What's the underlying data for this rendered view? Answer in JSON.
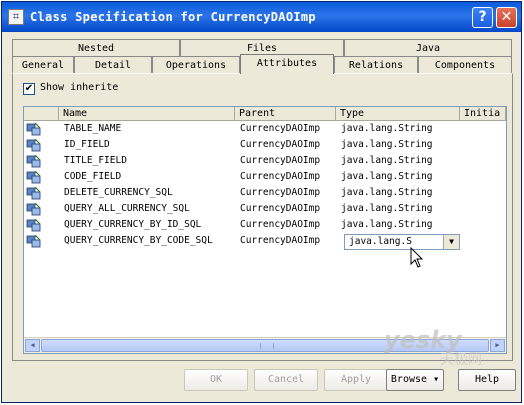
{
  "window": {
    "title": "Class Specification for CurrencyDAOImp"
  },
  "tabs": {
    "row_back": [
      "Nested",
      "Files",
      "Java"
    ],
    "row_front": [
      "General",
      "Detail",
      "Operations",
      "Attributes",
      "Relations",
      "Components"
    ],
    "active": "Attributes"
  },
  "options": {
    "show_inherited_label": "Show inherite",
    "show_inherited_checked": true
  },
  "table": {
    "headers": [
      "Name",
      "Parent",
      "Type",
      "Initia"
    ],
    "rows": [
      {
        "name": "TABLE_NAME",
        "parent": "CurrencyDAOImp",
        "type": "java.lang.String"
      },
      {
        "name": "ID_FIELD",
        "parent": "CurrencyDAOImp",
        "type": "java.lang.String"
      },
      {
        "name": "TITLE_FIELD",
        "parent": "CurrencyDAOImp",
        "type": "java.lang.String"
      },
      {
        "name": "CODE_FIELD",
        "parent": "CurrencyDAOImp",
        "type": "java.lang.String"
      },
      {
        "name": "DELETE_CURRENCY_SQL",
        "parent": "CurrencyDAOImp",
        "type": "java.lang.String"
      },
      {
        "name": "QUERY_ALL_CURRENCY_SQL",
        "parent": "CurrencyDAOImp",
        "type": "java.lang.String"
      },
      {
        "name": "QUERY_CURRENCY_BY_ID_SQL",
        "parent": "CurrencyDAOImp",
        "type": "java.lang.String"
      },
      {
        "name": "QUERY_CURRENCY_BY_CODE_SQL",
        "parent": "CurrencyDAOImp",
        "type": "java.lang.S"
      }
    ],
    "editing_row_type_value": "java.lang.S"
  },
  "buttons": {
    "ok": "OK",
    "cancel": "Cancel",
    "apply": "Apply",
    "browse": "Browse",
    "help": "Help"
  },
  "watermark": {
    "text": "yesky",
    "subtext": "天极网"
  },
  "icons": {
    "app": "class-spec-icon",
    "attribute": "attribute-icon",
    "help": "question-mark-icon",
    "close": "close-x-icon",
    "dropdown": "chevron-down-icon",
    "cursor": "mouse-pointer-icon"
  },
  "colors": {
    "titlebar": "#0a5bdc",
    "face": "#ece9d8",
    "close": "#c8422a",
    "grid_border": "#7f9db9"
  }
}
